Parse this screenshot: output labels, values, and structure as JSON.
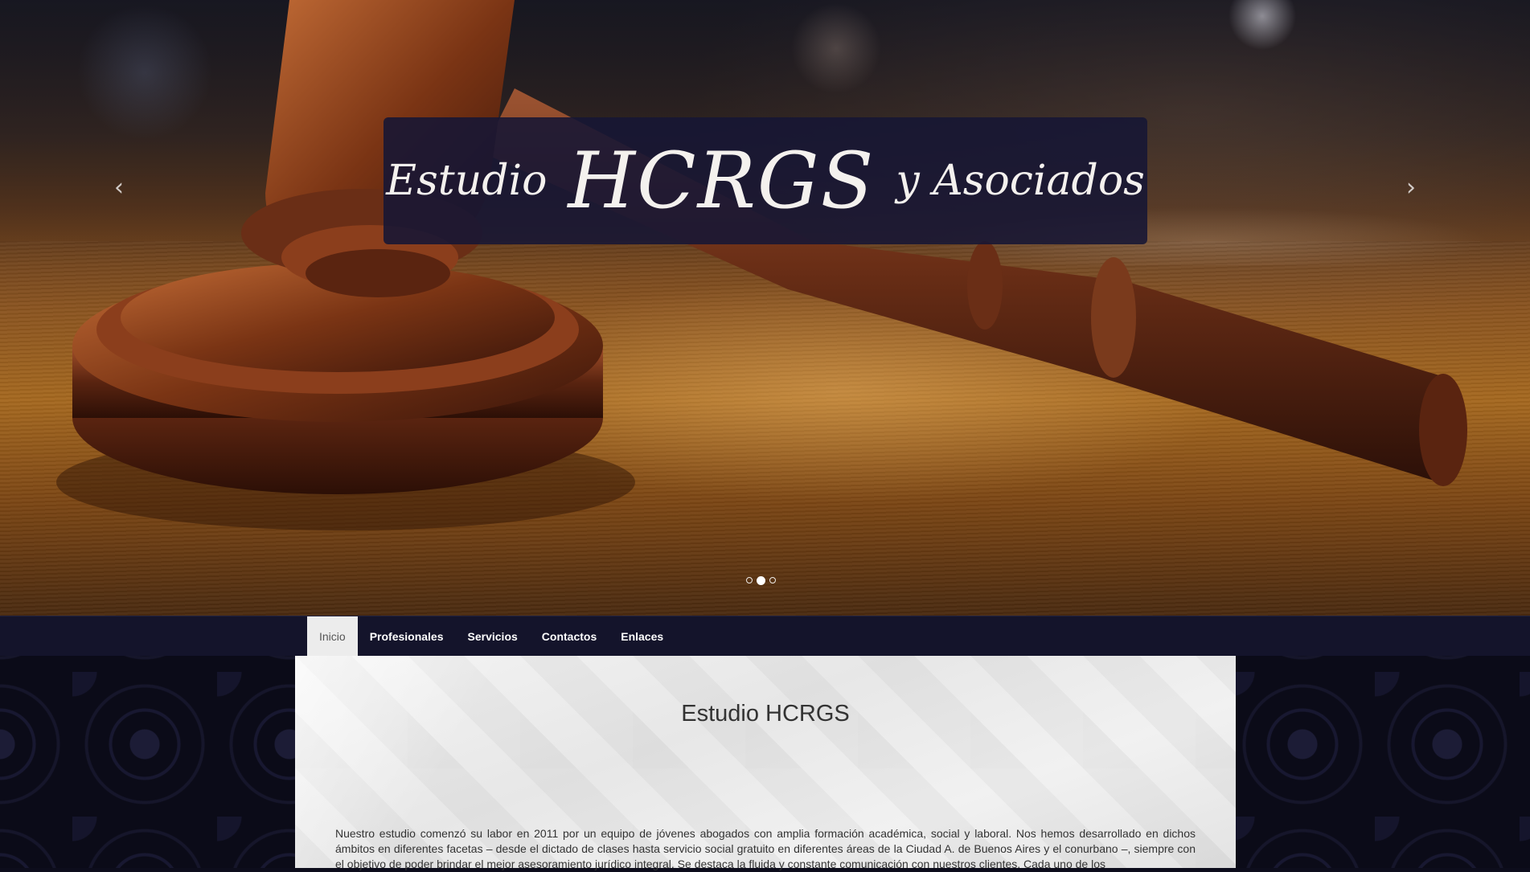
{
  "hero": {
    "banner": {
      "word1": "Estudio",
      "word2": "HCRGS",
      "word3": "y Asociados"
    },
    "prev_arrow": "‹",
    "next_arrow": "›",
    "slides_count": 3,
    "active_slide_index": 1
  },
  "nav": {
    "items": [
      {
        "label": "Inicio",
        "active": true
      },
      {
        "label": "Profesionales",
        "active": false
      },
      {
        "label": "Servicios",
        "active": false
      },
      {
        "label": "Contactos",
        "active": false
      },
      {
        "label": "Enlaces",
        "active": false
      }
    ]
  },
  "main": {
    "title": "Estudio HCRGS",
    "paragraph": "Nuestro estudio comenzó su labor en 2011 por un equipo de jóvenes abogados con amplia formación académica, social y laboral. Nos hemos desarrollado en dichos ámbitos en diferentes facetas – desde el dictado de clases hasta servicio social gratuito en diferentes áreas de la Ciudad A. de Buenos Aires y el conurbano –, siempre con el objetivo de poder brindar el mejor asesoramiento jurídico integral. Se destaca la fluida y constante comunicación con nuestros clientes. Cada uno de los"
  },
  "colors": {
    "nav_background": "#14142b",
    "banner_background": "#161634",
    "nav_active_background": "#ececec",
    "page_background": "#0b0b18"
  }
}
